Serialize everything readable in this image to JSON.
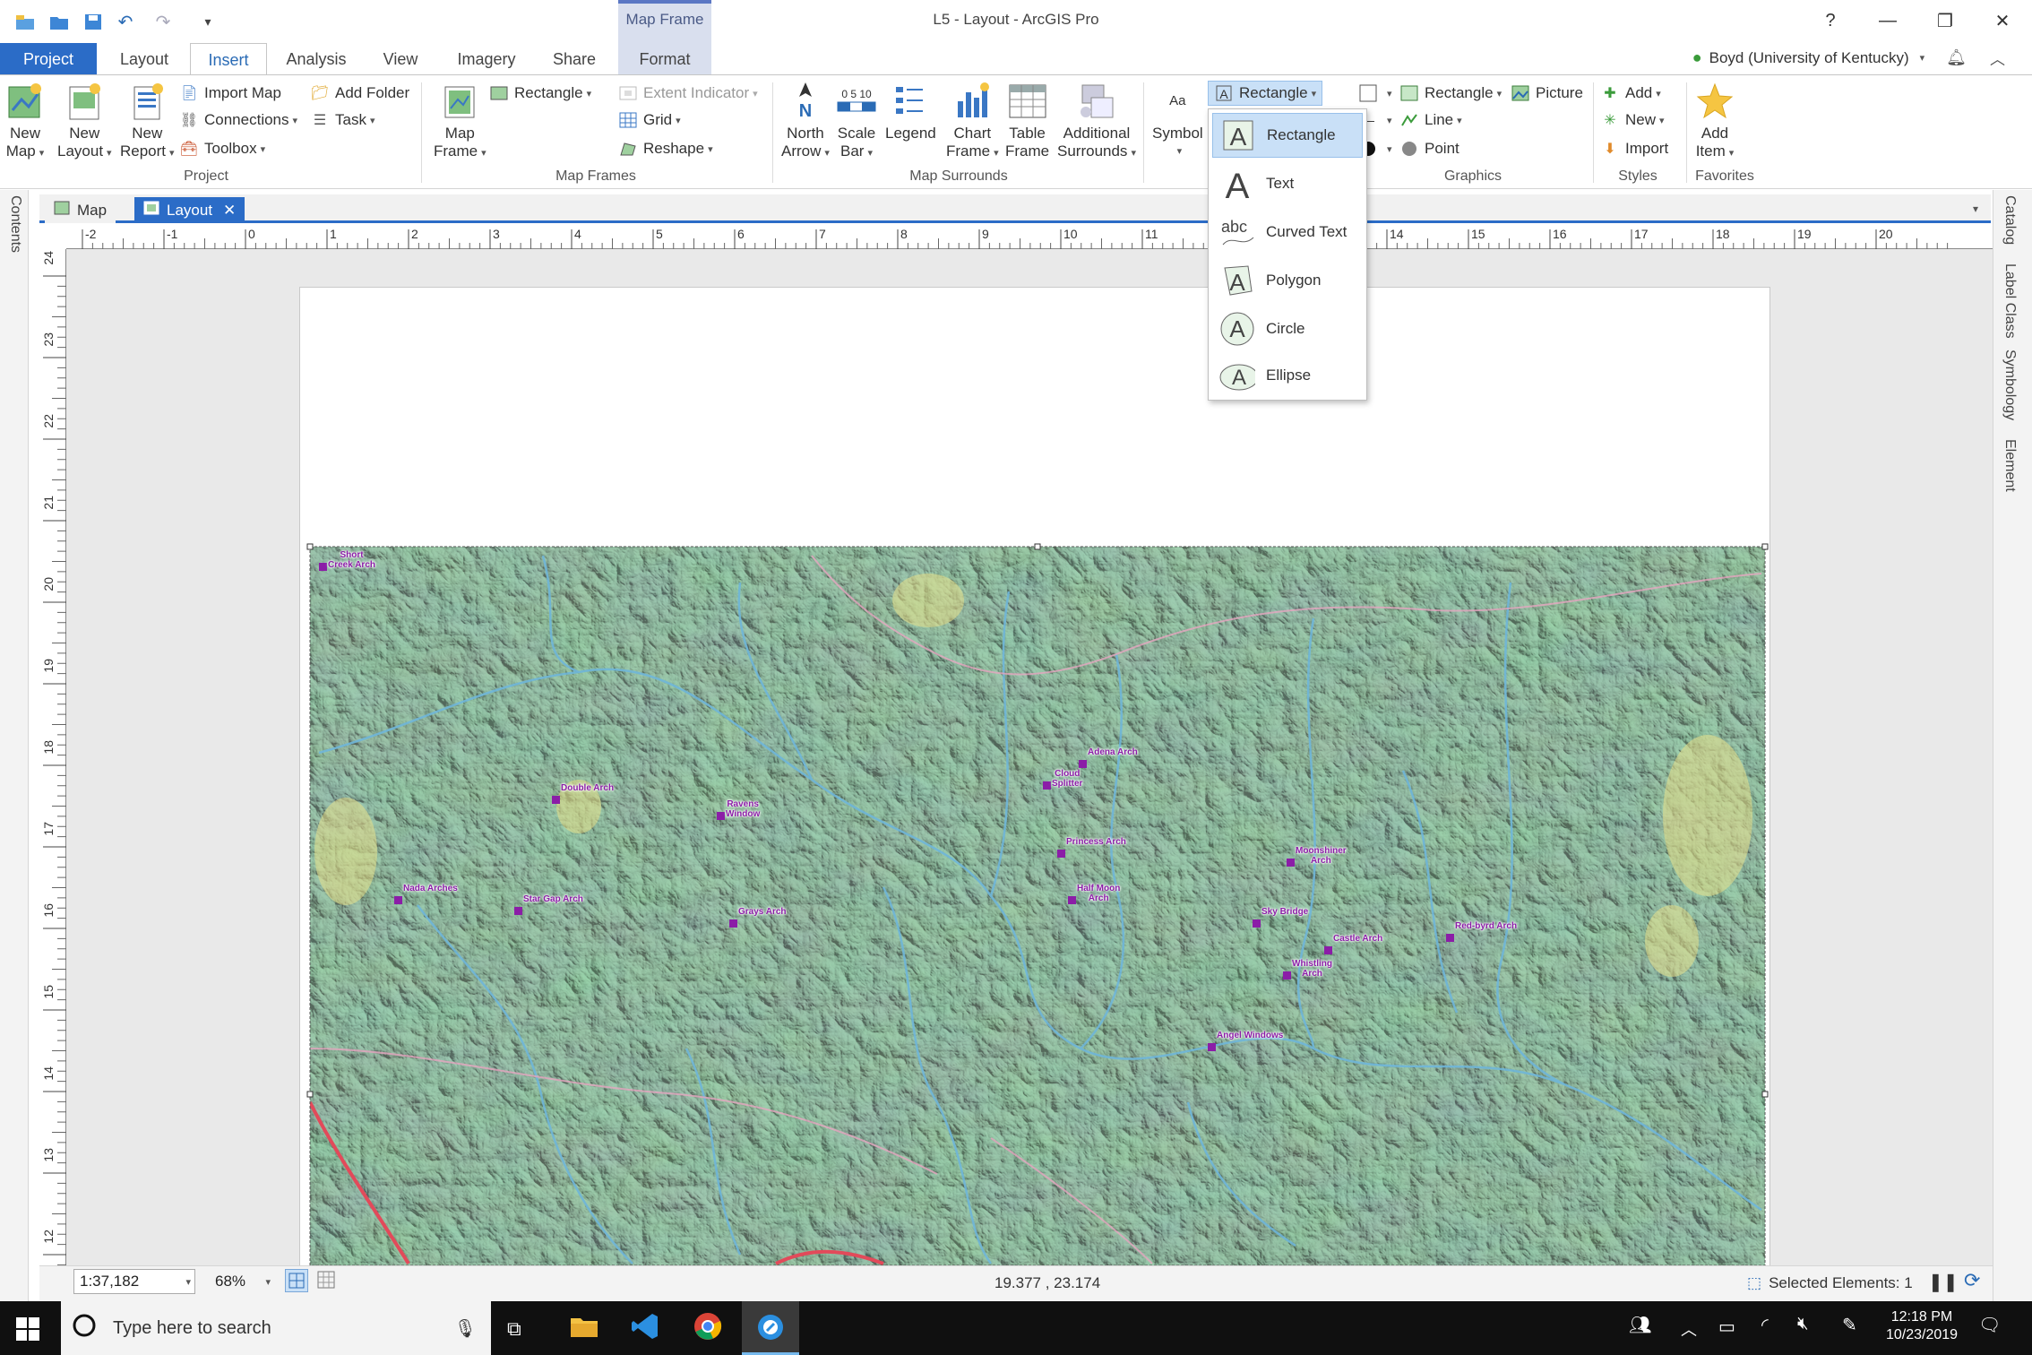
{
  "window": {
    "title": "L5 - Layout - ArcGIS Pro",
    "help": "?",
    "minimize": "—",
    "restore": "❐",
    "close": "✕"
  },
  "context_tab": {
    "label": "Map Frame"
  },
  "tabs": [
    "Project",
    "Layout",
    "Insert",
    "Analysis",
    "View",
    "Imagery",
    "Share",
    "Format"
  ],
  "active_tab": "Insert",
  "user": {
    "name": "Boyd (University of Kentucky)"
  },
  "ribbon": {
    "project": {
      "group": "Project",
      "new_map": [
        "New",
        "Map"
      ],
      "new_layout": [
        "New",
        "Layout"
      ],
      "new_report": [
        "New",
        "Report"
      ],
      "import_map": "Import Map",
      "connections": "Connections",
      "toolbox": "Toolbox",
      "add_folder": "Add Folder",
      "task": "Task"
    },
    "map_frames": {
      "group": "Map Frames",
      "map_frame": [
        "Map",
        "Frame"
      ],
      "rectangle": "Rectangle",
      "extent_indicator": "Extent Indicator",
      "grid": "Grid",
      "reshape": "Reshape"
    },
    "map_surrounds": {
      "group": "Map Surrounds",
      "north_arrow": [
        "North",
        "Arrow"
      ],
      "scale_bar": [
        "Scale",
        "Bar"
      ],
      "legend": "Legend",
      "chart_frame": [
        "Chart",
        "Frame"
      ],
      "table_frame": [
        "Table",
        "Frame"
      ],
      "additional": [
        "Additional",
        "Surrounds"
      ],
      "scale_ticks": "0 5 10"
    },
    "text": {
      "symbol": "Symbol",
      "aa": "Aa",
      "rectangle": "Rectangle"
    },
    "graphics": {
      "group": "Graphics",
      "rectangle": "Rectangle",
      "picture": "Picture",
      "line": "Line",
      "point": "Point"
    },
    "styles": {
      "group": "Styles",
      "add": "Add",
      "new": "New",
      "import": "Import"
    },
    "favorites": {
      "group": "Favorites",
      "add_item": [
        "Add",
        "Item"
      ]
    }
  },
  "shape_menu": [
    {
      "label": "Rectangle",
      "icon": "text-rectangle-icon"
    },
    {
      "label": "Text",
      "icon": "text-icon"
    },
    {
      "label": "Curved Text",
      "icon": "curved-text-icon"
    },
    {
      "label": "Polygon",
      "icon": "text-polygon-icon"
    },
    {
      "label": "Circle",
      "icon": "text-circle-icon"
    },
    {
      "label": "Ellipse",
      "icon": "text-ellipse-icon"
    }
  ],
  "sidebars": {
    "left": "Contents",
    "right": [
      "Catalog",
      "Label Class",
      "Symbology",
      "Element"
    ]
  },
  "view_tabs": [
    {
      "label": "Map"
    },
    {
      "label": "Layout",
      "active": true
    }
  ],
  "ruler_h": [
    "-2",
    "-1",
    "0",
    "1",
    "2",
    "3",
    "4",
    "5",
    "6",
    "7",
    "8",
    "9",
    "10",
    "11",
    "12",
    "13",
    "14",
    "15",
    "16",
    "17",
    "18",
    "19",
    "20"
  ],
  "ruler_v": [
    "24",
    "23",
    "22",
    "21",
    "20",
    "19",
    "18",
    "17",
    "16",
    "15",
    "14",
    "13",
    "12"
  ],
  "map_labels": [
    [
      "Short",
      "Creek Arch"
    ],
    [
      "Double Arch"
    ],
    [
      "Ravens",
      "Window"
    ],
    [
      "Adena Arch"
    ],
    [
      "Cloud",
      "Splitter"
    ],
    [
      "Princess Arch"
    ],
    [
      "Half Moon",
      "Arch"
    ],
    [
      "Nada Arches"
    ],
    [
      "Star Gap Arch"
    ],
    [
      "Grays Arch"
    ],
    [
      "Moonshiner",
      "Arch"
    ],
    [
      "Sky Bridge"
    ],
    [
      "Castle Arch"
    ],
    [
      "Red-byrd Arch"
    ],
    [
      "Whistling",
      "Arch"
    ],
    [
      "Angel Windows"
    ]
  ],
  "status": {
    "scale": "1:37,182",
    "zoom": "68%",
    "coords": "19.377 , 23.174",
    "selected": "Selected Elements: 1"
  },
  "taskbar": {
    "search_placeholder": "Type here to search",
    "time": "12:18 PM",
    "date": "10/23/2019"
  },
  "colors": {
    "accent": "#2b6cc7",
    "map_label": "#8b1da7",
    "terrain": "#8fc2a2"
  }
}
